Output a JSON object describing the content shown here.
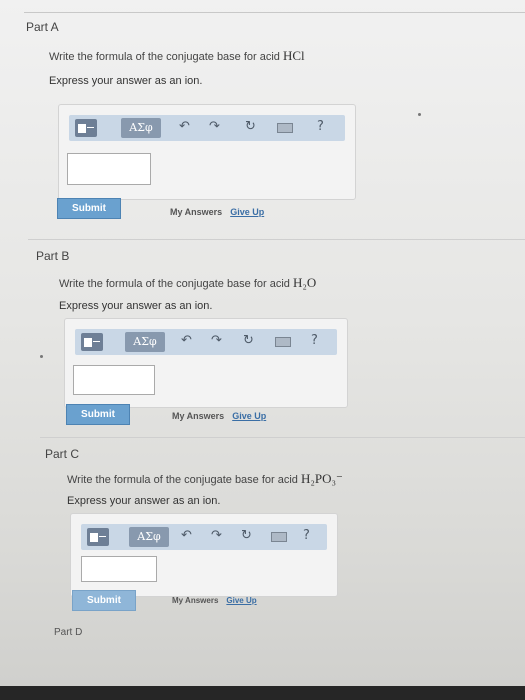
{
  "partA": {
    "title": "Part A",
    "question": "Write the formula of the conjugate base for acid",
    "formula": "HCl",
    "instruction": "Express your answer as an ion.",
    "greek": "ΑΣφ",
    "help": "?",
    "submit": "Submit",
    "my_answers": "My Answers",
    "give_up": "Give Up"
  },
  "partB": {
    "title": "Part B",
    "question": "Write the formula of the conjugate base for acid",
    "formula": "H₂O",
    "instruction": "Express your answer as an ion.",
    "greek": "ΑΣφ",
    "help": "?",
    "submit": "Submit",
    "my_answers": "My Answers",
    "give_up": "Give Up"
  },
  "partC": {
    "title": "Part C",
    "question": "Write the formula of the conjugate base for acid",
    "formula": "H₂PO₃⁻",
    "instruction": "Express your answer as an ion.",
    "greek": "ΑΣφ",
    "help": "?",
    "submit": "Submit",
    "my_answers": "My Answers",
    "give_up": "Give Up"
  },
  "partD": {
    "title": "Part D"
  },
  "icons": {
    "undo": "undo-icon",
    "redo": "redo-icon",
    "reset": "reset-icon",
    "keyboard": "keyboard-icon",
    "template": "fraction-template-icon"
  }
}
